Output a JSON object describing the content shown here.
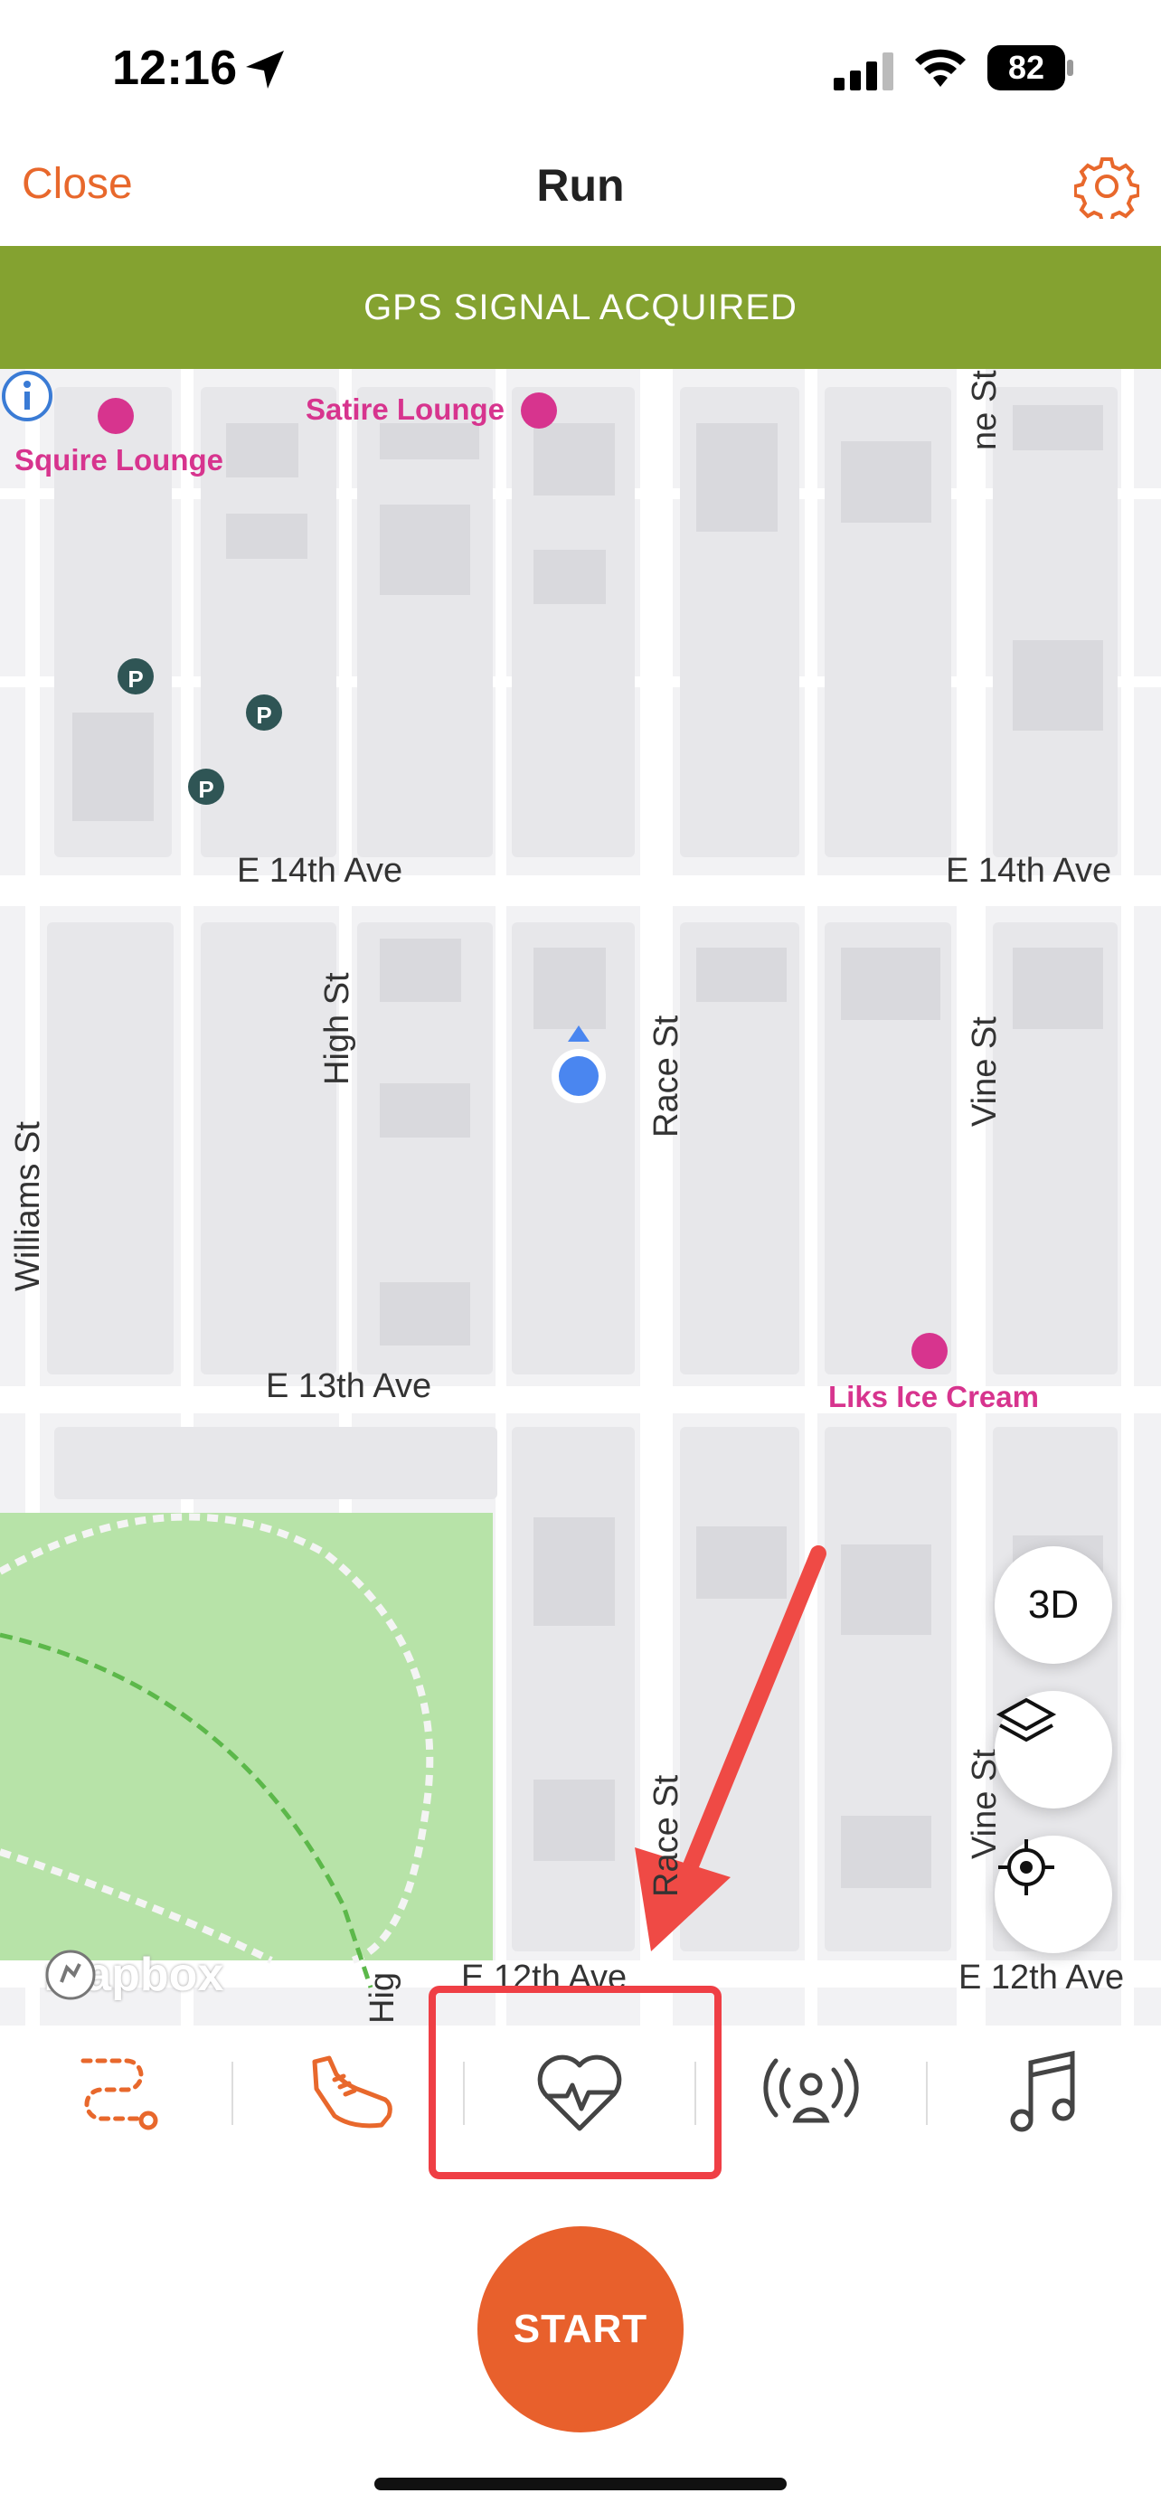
{
  "status_bar": {
    "time": "12:16",
    "battery": "82"
  },
  "nav": {
    "close_label": "Close",
    "title": "Run"
  },
  "gps_banner": "GPS SIGNAL ACQUIRED",
  "map": {
    "streets": {
      "e14_left": "E 14th Ave",
      "e14_right": "E 14th Ave",
      "e13": "E 13th Ave",
      "e12_mid": "E 12th Ave",
      "e12_right": "E 12th Ave",
      "high_st": "High St",
      "race_st": "Race St",
      "race_st_lower": "Race St",
      "vine_st": "Vine St",
      "vine_st_lower": "Vine St",
      "vine_st_top": "ne St",
      "williams_st": "Williams St",
      "high_st_lower": "Hig"
    },
    "pois": {
      "satire_lounge": "Satire Lounge",
      "squire_lounge": "Squire Lounge",
      "liks_ice_cream": "Liks Ice Cream"
    },
    "controls": {
      "three_d": "3D"
    },
    "attribution": "mapbox"
  },
  "tabs": [
    {
      "icon": "route-icon"
    },
    {
      "icon": "shoe-icon"
    },
    {
      "icon": "heart-rate-icon"
    },
    {
      "icon": "broadcast-icon"
    },
    {
      "icon": "music-icon"
    }
  ],
  "start_label": "START",
  "colors": {
    "accent": "#e8602c",
    "banner": "#84a230",
    "highlight": "#ef3f45",
    "location": "#4a86f0"
  }
}
